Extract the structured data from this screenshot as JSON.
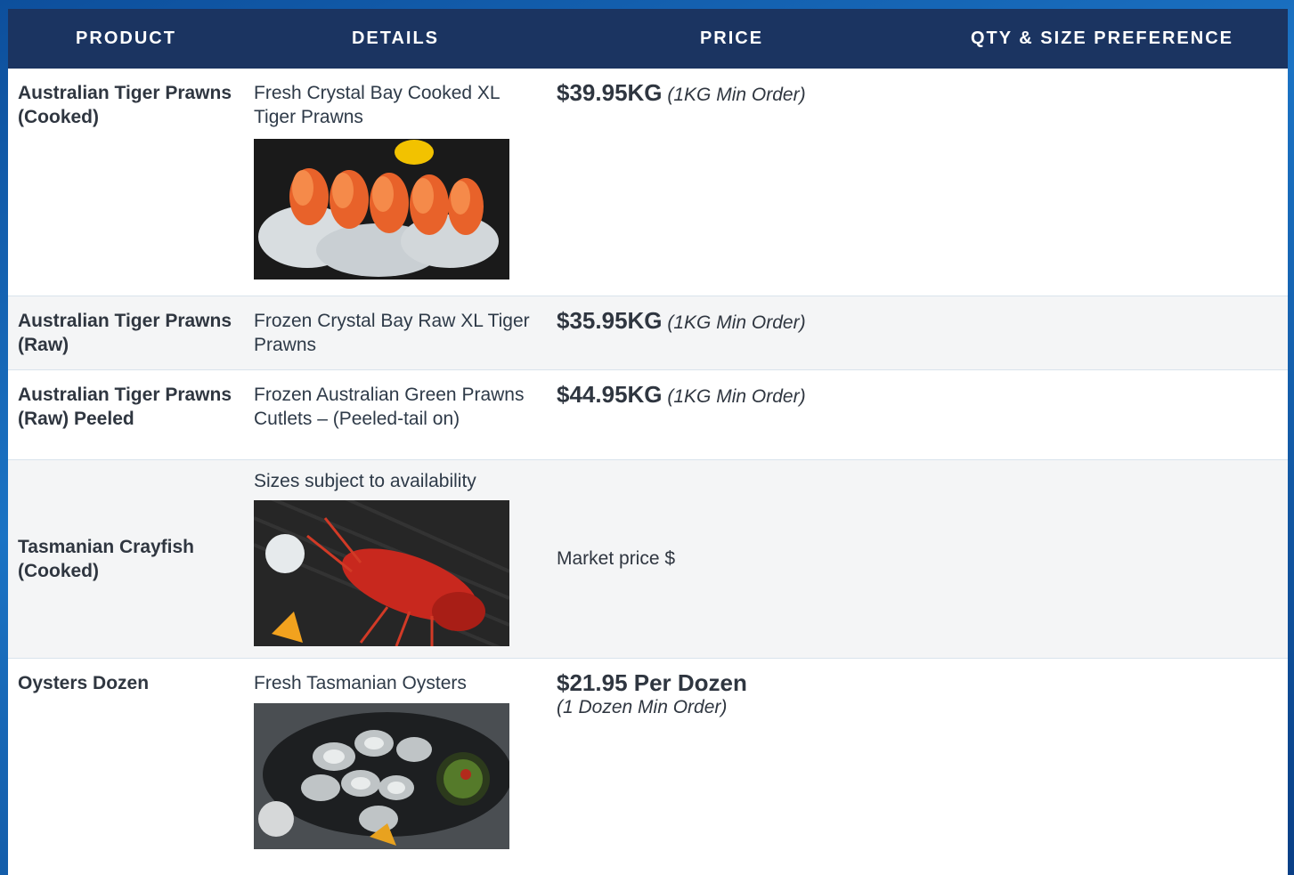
{
  "table": {
    "headers": [
      "PRODUCT",
      "DETAILS",
      "PRICE",
      "QTY & SIZE PREFERENCE"
    ],
    "rows": [
      {
        "name": "Australian Tiger Prawns (Cooked)",
        "detail": "Fresh Crystal Bay Cooked XL Tiger Prawns",
        "price": "$39.95KG",
        "min_order": "(1KG Min Order)",
        "image": "prawns-cooked-photo"
      },
      {
        "name": "Australian Tiger Prawns (Raw)",
        "detail": "Frozen Crystal Bay Raw XL Tiger Prawns",
        "price": "$35.95KG",
        "min_order": "(1KG Min Order)"
      },
      {
        "name": "Australian Tiger Prawns (Raw) Peeled",
        "detail": "Frozen Australian Green Prawns Cutlets – (Peeled-tail on)",
        "price": "$44.95KG",
        "min_order": "(1KG Min Order)"
      },
      {
        "name": "Tasmanian Crayfish (Cooked)",
        "detail": "Sizes subject to availability",
        "price_text": "Market price $",
        "image": "crayfish-photo"
      },
      {
        "name": "Oysters Dozen",
        "detail": "Fresh Tasmanian Oysters",
        "price": "$21.95 Per Dozen",
        "min_order": "(1 Dozen Min Order)",
        "image": "oysters-photo"
      }
    ]
  },
  "colors": {
    "header_bg": "#1b3461",
    "page_bg": "#1b73c4",
    "alt_row_bg": "#f4f5f6"
  }
}
